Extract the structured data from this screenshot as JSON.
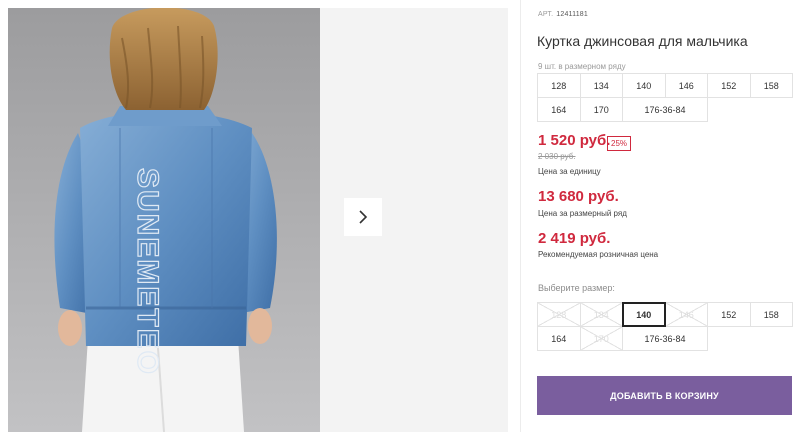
{
  "product": {
    "art_label": "АРТ.",
    "art_number": "12411181",
    "title": "Куртка джинсовая для мальчика"
  },
  "pack": {
    "caption": "9 шт. в размерном ряду",
    "sizes": [
      "128",
      "134",
      "140",
      "146",
      "152",
      "158",
      "164",
      "170",
      "176-36-84"
    ]
  },
  "prices": {
    "unit_price": "1 520 руб.",
    "discount": "25%",
    "old_price": "2 030 руб.",
    "unit_caption": "Цена за единицу",
    "pack_price": "13 680 руб.",
    "pack_caption": "Цена за размерный ряд",
    "retail_price": "2 419 руб.",
    "retail_caption": "Рекомендуемая розничная цена",
    "color_accent": "#d0293e"
  },
  "size_select": {
    "caption": "Выберите размер:",
    "sizes": [
      {
        "label": "128",
        "state": "disabled"
      },
      {
        "label": "134",
        "state": "disabled"
      },
      {
        "label": "140",
        "state": "selected"
      },
      {
        "label": "146",
        "state": "disabled"
      },
      {
        "label": "152",
        "state": "available"
      },
      {
        "label": "158",
        "state": "available"
      },
      {
        "label": "164",
        "state": "available"
      },
      {
        "label": "170",
        "state": "disabled"
      },
      {
        "label": "176-36-84",
        "state": "available"
      }
    ]
  },
  "cart": {
    "button_label": "ДОБАВИТЬ В КОРЗИНУ",
    "button_color": "#7a5e9e"
  },
  "gallery": {
    "next_icon": "chevron-right-icon",
    "jacket_print": "SUNEMETEO"
  }
}
